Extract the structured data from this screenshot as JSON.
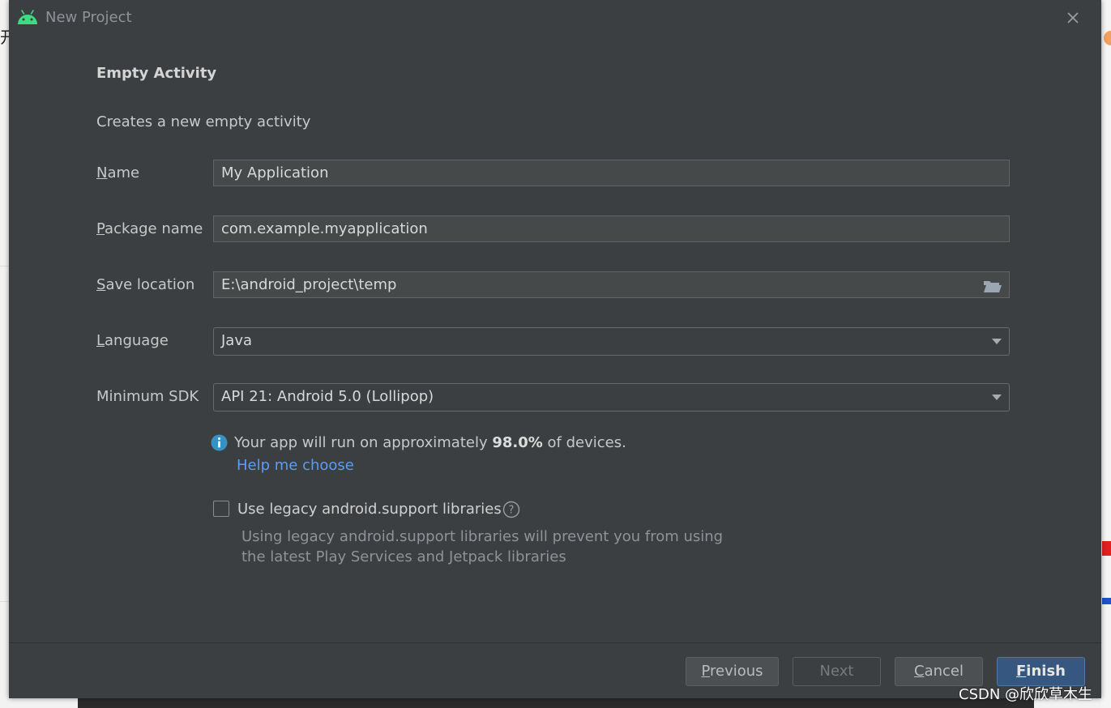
{
  "window": {
    "title": "New Project",
    "app_icon": "android-icon",
    "close_icon": "close-icon"
  },
  "template": {
    "heading": "Empty Activity",
    "description": "Creates a new empty activity"
  },
  "form": {
    "name": {
      "label_mnemonic": "N",
      "label_rest": "ame",
      "value": "My Application"
    },
    "package_name": {
      "label_mnemonic": "P",
      "label_rest": "ackage name",
      "value": "com.example.myapplication"
    },
    "save_location": {
      "label_mnemonic": "S",
      "label_rest": "ave location",
      "value": "E:\\android_project\\temp",
      "icon": "folder-icon"
    },
    "language": {
      "label_mnemonic": "L",
      "label_rest": "anguage",
      "value": "Java"
    },
    "minimum_sdk": {
      "label": "Minimum SDK",
      "value": "API 21: Android 5.0 (Lollipop)"
    }
  },
  "sdk_info": {
    "icon": "info-icon",
    "text_before": "Your app will run on approximately ",
    "percentage": "98.0%",
    "text_after": " of devices.",
    "help_link": "Help me choose"
  },
  "legacy_support": {
    "checked": false,
    "label": "Use legacy android.support libraries",
    "help_icon": "question-circle-icon",
    "note_line1": "Using legacy android.support libraries will prevent you from using",
    "note_line2": "the latest Play Services and Jetpack libraries"
  },
  "buttons": {
    "previous": {
      "mnemonic": "P",
      "rest": "revious"
    },
    "next": {
      "label": "Next",
      "enabled": false
    },
    "cancel": {
      "mnemonic": "C",
      "rest": "ancel"
    },
    "finish": {
      "mnemonic": "F",
      "rest": "inish"
    }
  },
  "colors": {
    "dialog_bg": "#3c3f41",
    "link": "#589df6",
    "primary_button": "#365880",
    "android_green": "#3ddc84",
    "info_blue": "#3592c4"
  },
  "watermark": "CSDN @欣欣草木生"
}
